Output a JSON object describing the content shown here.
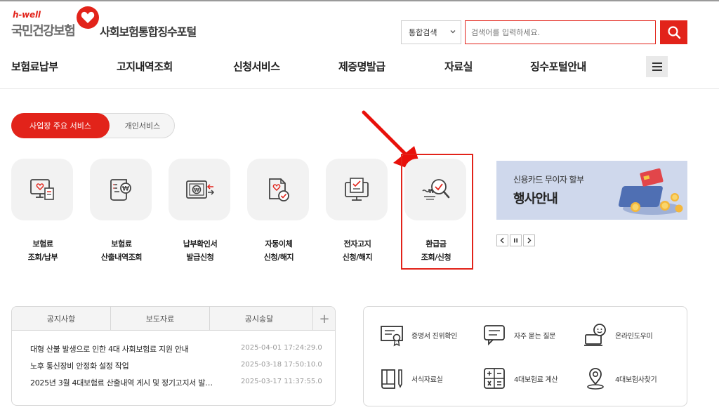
{
  "brand": {
    "tagline": "h-well",
    "org_name": "국민건강보험",
    "portal_name": "사회보험통합징수포털"
  },
  "search": {
    "scope_selected": "통합검색",
    "placeholder": "검색어를 입력하세요."
  },
  "nav": {
    "items": [
      "보험료납부",
      "고지내역조회",
      "신청서비스",
      "제증명발급",
      "자료실",
      "징수포털안내"
    ]
  },
  "service_tabs": {
    "active": "사업장 주요 서비스",
    "inactive": "개인서비스"
  },
  "services": [
    {
      "line1": "보험료",
      "line2": "조회/납부",
      "icon": "bill-monitor-icon"
    },
    {
      "line1": "보험료",
      "line2": "산출내역조회",
      "icon": "calculation-scroll-icon"
    },
    {
      "line1": "납부확인서",
      "line2": "발급신청",
      "icon": "payment-certificate-icon"
    },
    {
      "line1": "자동이체",
      "line2": "신청/해지",
      "icon": "auto-transfer-doc-icon"
    },
    {
      "line1": "전자고지",
      "line2": "신청/해지",
      "icon": "e-notice-monitor-icon"
    },
    {
      "line1": "환급금",
      "line2": "조회/신청",
      "icon": "refund-search-icon"
    }
  ],
  "banner": {
    "subtitle": "신용카드 무이자 할부",
    "title": "행사안내"
  },
  "notice": {
    "tabs": [
      "공지사항",
      "보도자료",
      "공시송달"
    ],
    "more": "+",
    "items": [
      {
        "title": "대형 산불 발생으로 인한 4대 사회보험료 지원 안내",
        "date": "2025-04-01 17:24:29.0"
      },
      {
        "title": "노후 통신장비 안정화 설정 작업",
        "date": "2025-03-18 17:50:10.0"
      },
      {
        "title": "2025년 3월 4대보험료 산출내역 게시 및 정기고지서 발…",
        "date": "2025-03-17 11:37:55.0"
      }
    ]
  },
  "quick_links": [
    {
      "label": "증명서 진위확인",
      "icon": "certificate-verify-icon"
    },
    {
      "label": "자주 묻는 질문",
      "icon": "faq-chat-icon"
    },
    {
      "label": "온라인도우미",
      "icon": "online-helper-icon"
    },
    {
      "label": "서식자료실",
      "icon": "form-book-icon"
    },
    {
      "label": "4대보험료 계산",
      "icon": "calculator-icon"
    },
    {
      "label": "4대보험사찾기",
      "icon": "location-pin-icon"
    }
  ],
  "colors": {
    "brand_red": "#e2231a",
    "banner_bg": "#cfd8ec",
    "tile_bg": "#f2f2f2"
  }
}
